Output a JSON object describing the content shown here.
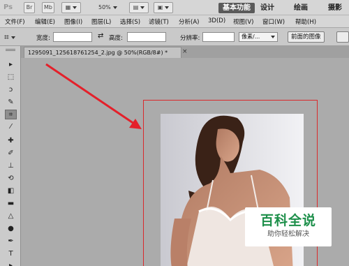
{
  "appbar": {
    "logo": "Ps",
    "bridge_label": "Br",
    "minibridge_label": "Mb",
    "zoom": "50%",
    "workspaces": [
      "基本功能",
      "设计",
      "绘画",
      "摄影"
    ]
  },
  "menu": [
    "文件(F)",
    "编辑(E)",
    "图像(I)",
    "图层(L)",
    "选择(S)",
    "滤镜(T)",
    "分析(A)",
    "3D(D)",
    "视图(V)",
    "窗口(W)",
    "帮助(H)"
  ],
  "options": {
    "width_label": "宽度:",
    "height_label": "高度:",
    "resolution_label": "分辨率:",
    "unit_value": "像素/...",
    "front_image_button": "前面的图像"
  },
  "document": {
    "tab_title": "1295091_1256187612­54_2.jpg @ 50%(RGB/8#) *",
    "close_symbol": "×"
  },
  "watermark": {
    "title": "百科全说",
    "subtitle": "助你轻松解决"
  },
  "colors": {
    "crop_border": "#d9292b",
    "arrow": "#e4202a",
    "watermark_green": "#1d8f4a"
  }
}
